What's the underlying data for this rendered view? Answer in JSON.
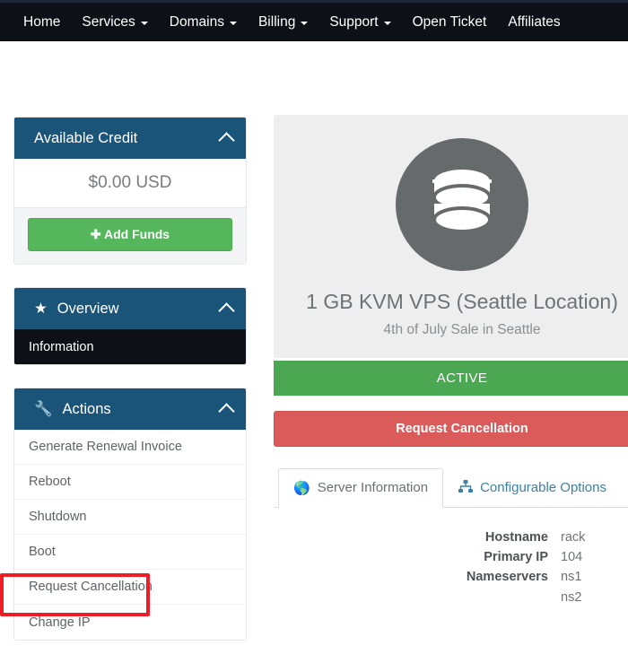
{
  "navbar": {
    "items": [
      {
        "label": "Home",
        "caret": false
      },
      {
        "label": "Services",
        "caret": true
      },
      {
        "label": "Domains",
        "caret": true
      },
      {
        "label": "Billing",
        "caret": true
      },
      {
        "label": "Support",
        "caret": true
      },
      {
        "label": "Open Ticket",
        "caret": false
      },
      {
        "label": "Affiliates",
        "caret": false
      }
    ]
  },
  "sidebar": {
    "credit": {
      "title": "Available Credit",
      "amount": "$0.00 USD",
      "add_funds_label": "Add Funds"
    },
    "overview": {
      "title": "Overview",
      "items": [
        {
          "label": "Information",
          "active": true
        }
      ]
    },
    "actions": {
      "title": "Actions",
      "items": [
        {
          "label": "Generate Renewal Invoice",
          "active": false
        },
        {
          "label": "Reboot",
          "active": false
        },
        {
          "label": "Shutdown",
          "active": false
        },
        {
          "label": "Boot",
          "active": false
        },
        {
          "label": "Request Cancellation",
          "active": false
        },
        {
          "label": "Change IP",
          "active": false
        }
      ]
    }
  },
  "main": {
    "product": {
      "title": "1 GB KVM VPS (Seattle Location)",
      "subtitle": "4th of July Sale in Seattle"
    },
    "status": "ACTIVE",
    "cancel_label": "Request Cancellation",
    "tabs": [
      {
        "label": "Server Information",
        "icon": "globe-icon",
        "active": true
      },
      {
        "label": "Configurable Options",
        "icon": "sitemap-icon",
        "active": false
      }
    ],
    "server_info": {
      "hostname_label": "Hostname",
      "hostname_value": "rack",
      "primary_ip_label": "Primary IP",
      "primary_ip_value": "104",
      "nameservers_label": "Nameservers",
      "nameserver_1": "ns1",
      "nameserver_2": "ns2"
    }
  },
  "annotation": {
    "highlight_target": "Change IP",
    "highlight_color": "#ef1c24"
  },
  "colors": {
    "navbar_bg": "#0d1117",
    "panel_head_bg": "#1b5479",
    "green": "#56b65c",
    "status_green": "#4ba751",
    "red": "#db5a5a",
    "link_blue": "#3d7fa6"
  }
}
